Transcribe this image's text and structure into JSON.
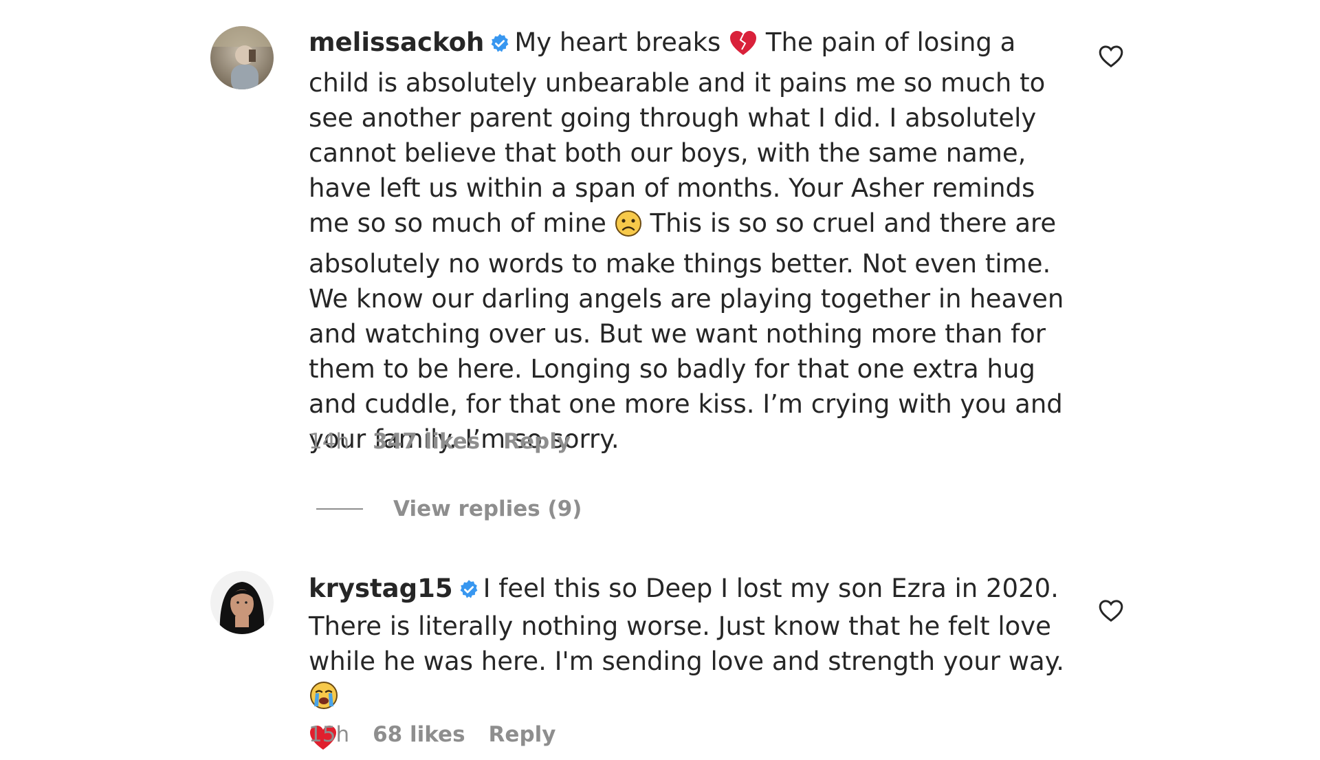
{
  "comments": [
    {
      "username": "melissackoh",
      "verified": true,
      "text_parts": {
        "p1": "My heart breaks",
        "p2": "The pain of losing a child is absolutely unbearable and it pains me so much to see another parent going through what I did. I absolutely cannot believe that both our boys, with the same name, have left us within a span of months. Your Asher reminds me so so much of mine",
        "p3": "This is so so cruel and there are absolutely no words to make things better. Not even time. We know our darling angels are playing together in heaven and watching over us. But we want nothing more than for them to be here. Longing so badly for that one extra hug and cuddle, for that one more kiss. I’m crying with you and your family. I’m so sorry."
      },
      "emojis": [
        "broken-heart",
        "frowning-face"
      ],
      "time": "14h",
      "likes": "347 likes",
      "reply_label": "Reply",
      "view_replies": "View replies (9)"
    },
    {
      "username": "krystag15",
      "verified": true,
      "text_parts": {
        "p1": "I feel this so Deep I lost my son Ezra in 2020. There is literally nothing worse. Just know that he felt love while he was here. I'm sending love and strength your way."
      },
      "emojis": [
        "loudly-crying-face",
        "red-heart"
      ],
      "time": "15h",
      "likes": "68 likes",
      "reply_label": "Reply"
    }
  ],
  "colors": {
    "text": "#262626",
    "secondary": "#8e8e8e",
    "verified": "#3897f0",
    "heart_red": "#e0245e"
  },
  "icons": {
    "verified": "verified-badge-icon",
    "like": "heart-outline-icon"
  }
}
